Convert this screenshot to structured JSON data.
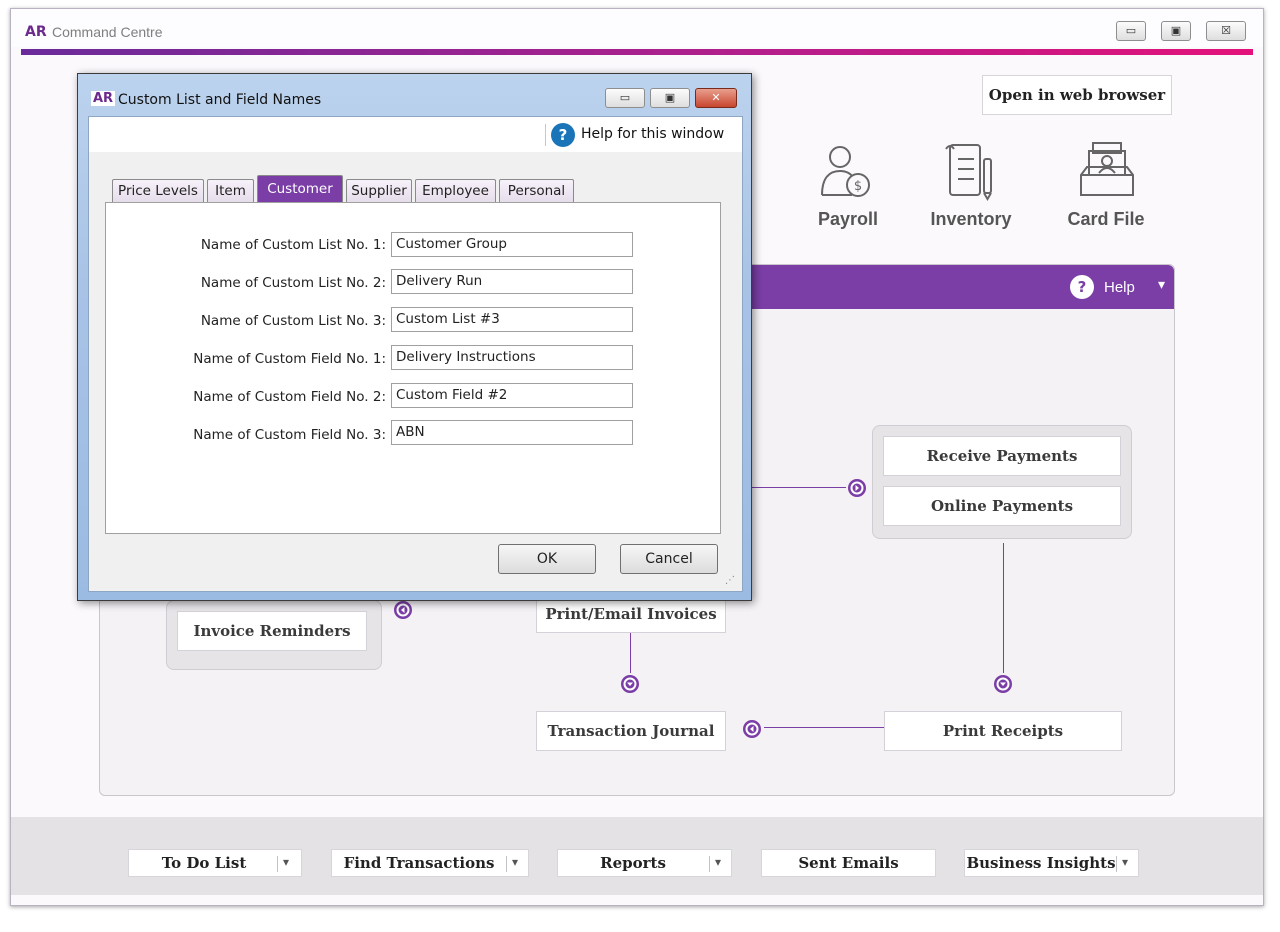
{
  "main_window": {
    "logo": "AR",
    "title": "Command Centre",
    "controls": {
      "minimize": "▭",
      "restore": "▣",
      "close": "☒"
    }
  },
  "top": {
    "open_browser": "Open in web browser",
    "modules": [
      {
        "label": "Payroll",
        "icon": "payroll-icon"
      },
      {
        "label": "Inventory",
        "icon": "inventory-icon"
      },
      {
        "label": "Card File",
        "icon": "card-file-icon"
      }
    ]
  },
  "panel": {
    "help_label": "Help",
    "help_glyph": "?",
    "dropdown_glyph": "▾",
    "buttons": {
      "receive_payments": "Receive Payments",
      "online_payments": "Online Payments",
      "print_email_invoices": "Print/Email Invoices",
      "invoice_reminders": "Invoice Reminders",
      "transaction_journal": "Transaction Journal",
      "print_receipts": "Print Receipts"
    }
  },
  "bottom_bar": [
    {
      "label": "To Do List",
      "has_dropdown": true
    },
    {
      "label": "Find Transactions",
      "has_dropdown": true
    },
    {
      "label": "Reports",
      "has_dropdown": true
    },
    {
      "label": "Sent Emails",
      "has_dropdown": false
    },
    {
      "label": "Business Insights",
      "has_dropdown": true
    }
  ],
  "dialog": {
    "logo": "AR",
    "title": "Custom List and Field Names",
    "help_link": "Help for this window",
    "help_glyph": "?",
    "tabs": [
      {
        "label": "Price Levels",
        "active": false
      },
      {
        "label": "Item",
        "active": false
      },
      {
        "label": "Customer",
        "active": true
      },
      {
        "label": "Supplier",
        "active": false
      },
      {
        "label": "Employee",
        "active": false
      },
      {
        "label": "Personal",
        "active": false
      }
    ],
    "fields": [
      {
        "label": "Name of Custom List No. 1:",
        "value": "Customer Group"
      },
      {
        "label": "Name of Custom List No. 2:",
        "value": "Delivery Run"
      },
      {
        "label": "Name of Custom List No. 3:",
        "value": "Custom List #3"
      },
      {
        "label": "Name of Custom Field No. 1:",
        "value": "Delivery Instructions"
      },
      {
        "label": "Name of Custom Field No. 2:",
        "value": "Custom Field #2"
      },
      {
        "label": "Name of Custom Field No. 3:",
        "value": "ABN"
      }
    ],
    "ok": "OK",
    "cancel": "Cancel"
  },
  "colors": {
    "accent": "#7a3ea6",
    "dialog_frame": "#a8c3e6",
    "close_red": "#c8452f"
  }
}
